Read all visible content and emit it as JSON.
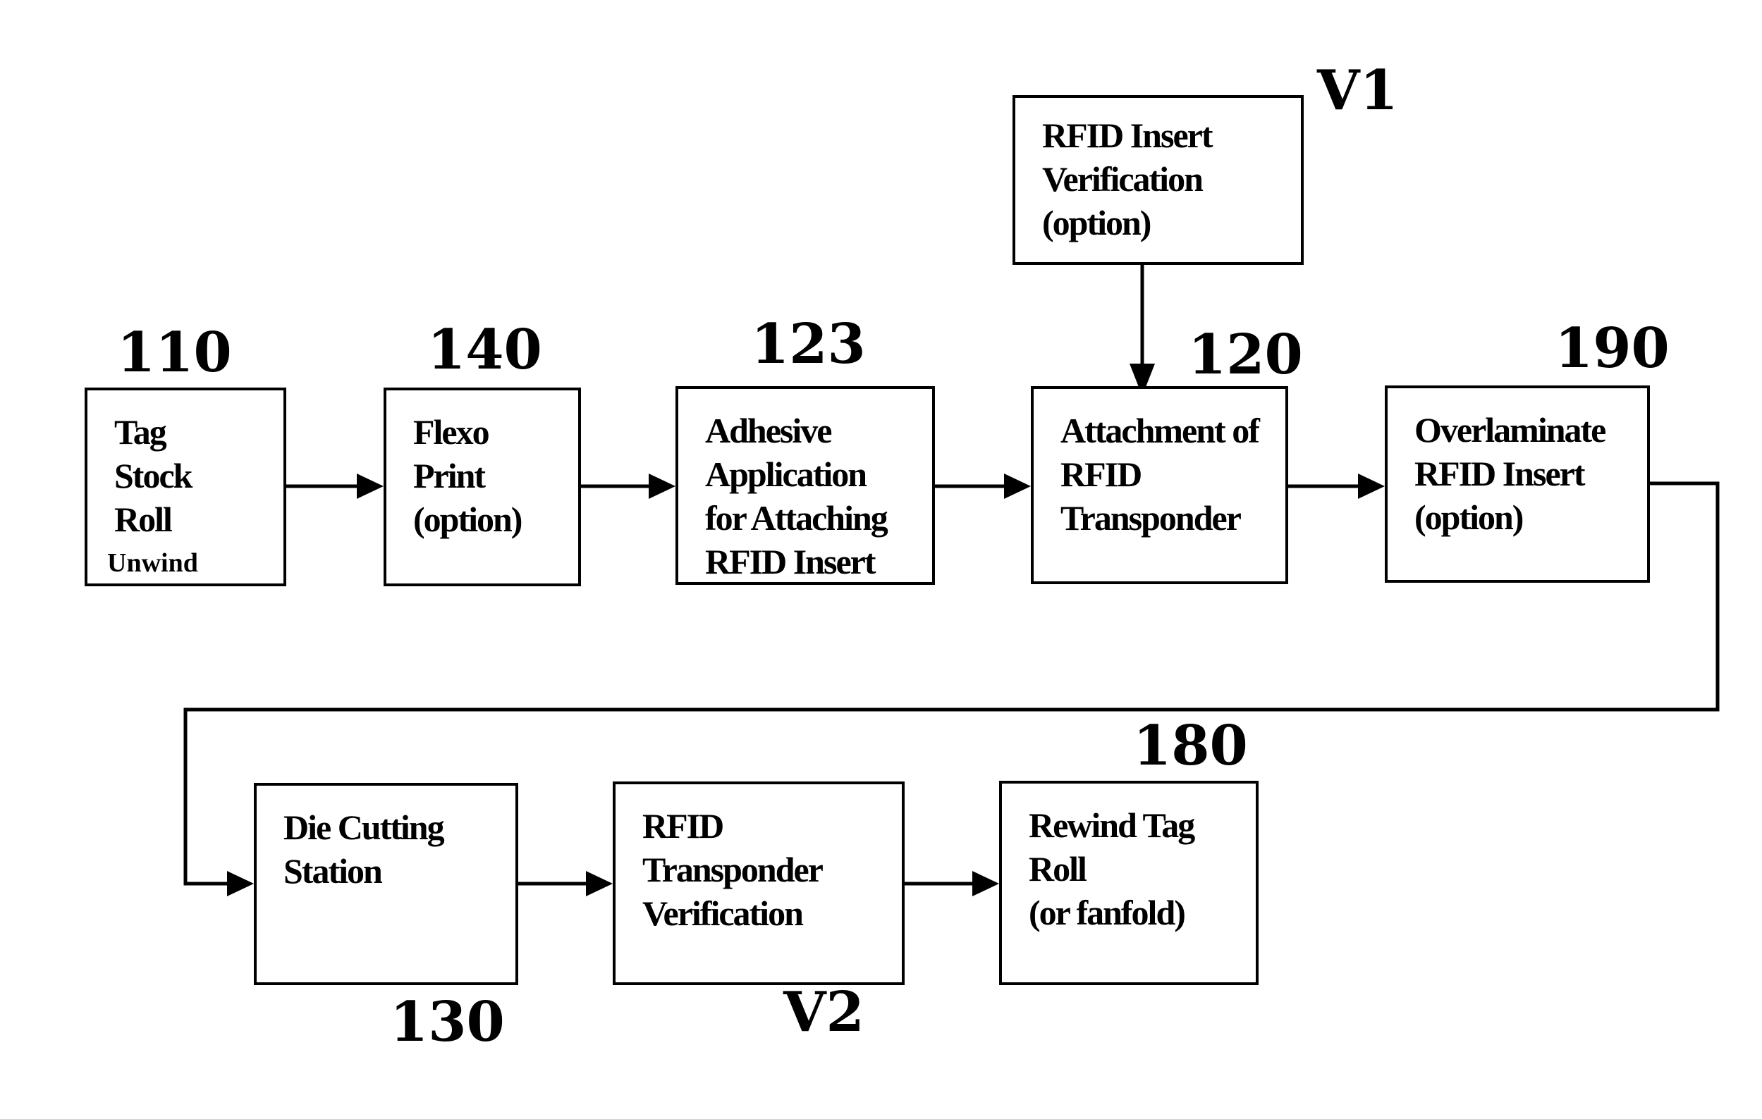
{
  "diagram": {
    "type": "process-flow",
    "nodes": [
      {
        "id": "110",
        "ref": "110",
        "lines": [
          "Tag",
          "Stock",
          "Roll"
        ],
        "sub": "Unwind"
      },
      {
        "id": "140",
        "ref": "140",
        "lines": [
          "Flexo",
          "Print",
          "(option)"
        ]
      },
      {
        "id": "123",
        "ref": "123",
        "lines": [
          "Adhesive",
          "Application",
          "for Attaching",
          "RFID Insert"
        ]
      },
      {
        "id": "120",
        "ref": "120",
        "lines": [
          "Attachment of",
          "RFID",
          "Transponder"
        ]
      },
      {
        "id": "190",
        "ref": "190",
        "lines": [
          "Overlaminate",
          "RFID Insert",
          "(option)"
        ]
      },
      {
        "id": "V1",
        "ref": "V1",
        "lines": [
          "RFID Insert",
          "Verification",
          "(option)"
        ]
      },
      {
        "id": "130",
        "ref": "130",
        "lines": [
          "Die Cutting",
          "Station"
        ]
      },
      {
        "id": "V2",
        "ref": "V2",
        "lines": [
          "RFID",
          "Transponder",
          "Verification"
        ]
      },
      {
        "id": "180",
        "ref": "180",
        "lines": [
          "Rewind Tag",
          "Roll",
          "(or fanfold)"
        ]
      }
    ],
    "edges": [
      {
        "from": "110",
        "to": "140"
      },
      {
        "from": "140",
        "to": "123"
      },
      {
        "from": "123",
        "to": "120"
      },
      {
        "from": "V1",
        "to": "120"
      },
      {
        "from": "120",
        "to": "190"
      },
      {
        "from": "190",
        "to": "130"
      },
      {
        "from": "130",
        "to": "V2"
      },
      {
        "from": "V2",
        "to": "180"
      }
    ]
  }
}
